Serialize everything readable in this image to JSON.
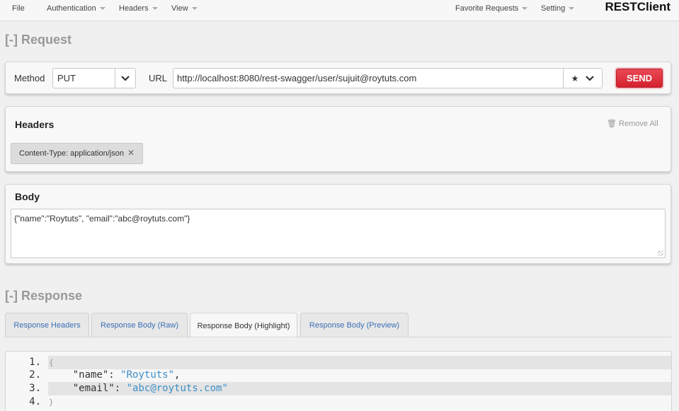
{
  "menubar": {
    "items": [
      {
        "label": "File"
      },
      {
        "label": "Authentication"
      },
      {
        "label": "Headers"
      },
      {
        "label": "View"
      },
      {
        "label": "Favorite Requests"
      },
      {
        "label": "Setting"
      }
    ],
    "brand": "RESTClient"
  },
  "request": {
    "section_title": "[-] Request",
    "method_label": "Method",
    "method_value": "PUT",
    "url_label": "URL",
    "url_value": "http://localhost:8080/rest-swagger/user/sujuit@roytuts.com",
    "send_label": "SEND",
    "icons": [
      "star-icon",
      "chevron-down-icon"
    ]
  },
  "headers": {
    "title": "Headers",
    "remove_all": "Remove All",
    "chips": [
      {
        "label": "Content-Type: application/json"
      }
    ]
  },
  "body": {
    "title": "Body",
    "value": "{\"name\":\"Roytuts\", \"email\":\"abc@roytuts.com\"}"
  },
  "response": {
    "section_title": "[-] Response",
    "tabs": [
      {
        "label": "Response Headers"
      },
      {
        "label": "Response Body (Raw)"
      },
      {
        "label": "Response Body (Highlight)"
      },
      {
        "label": "Response Body (Preview)"
      }
    ],
    "active_tab": "Response Body (Highlight)",
    "code": {
      "line_numbers": [
        "1.",
        "2.",
        "3.",
        "4."
      ],
      "open_brace": "{",
      "close_brace": "}",
      "k1": "\"name\"",
      "v1": "\"Roytuts\"",
      "k2": "\"email\"",
      "v2": "\"abc@roytuts.com\"",
      "colon": ":",
      "comma": ","
    }
  },
  "colors": {
    "send": "#d4202e",
    "tab_link": "#3a6fb4",
    "json_string": "#3d8fc8"
  }
}
